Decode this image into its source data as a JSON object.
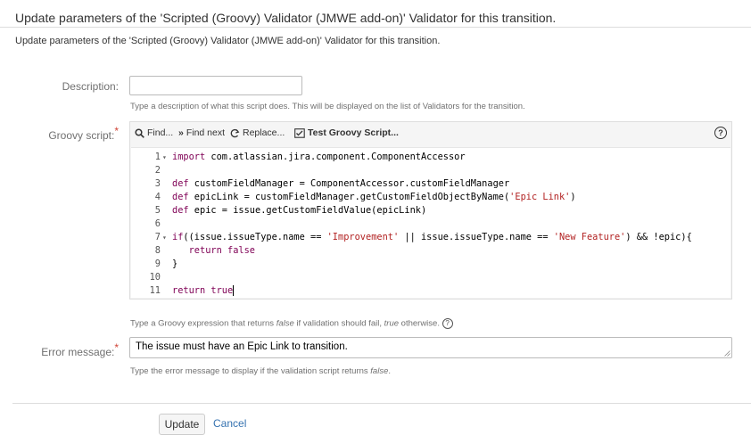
{
  "page": {
    "title": "Update parameters of the 'Scripted (Groovy) Validator (JMWE add-on)' Validator for this transition.",
    "intro": "Update parameters of the 'Scripted (Groovy) Validator (JMWE add-on)' Validator for this transition."
  },
  "description": {
    "label": "Description:",
    "value": "",
    "help": "Type a description of what this script does. This will be displayed on the list of Validators for the transition."
  },
  "groovy": {
    "label": "Groovy script:",
    "required_mark": "*",
    "toolbar": {
      "find": "Find...",
      "find_next": "Find next",
      "replace": "Replace...",
      "test": "Test Groovy Script..."
    },
    "help_before": "Type a Groovy expression that returns ",
    "help_em1": "false",
    "help_mid": " if validation should fail, ",
    "help_em2": "true",
    "help_after": " otherwise.",
    "lines": [
      {
        "n": "1",
        "fold": "▾",
        "parts": [
          {
            "t": "import",
            "c": "kw"
          },
          {
            "t": " com.atlassian.jira.component.ComponentAccessor",
            "c": ""
          }
        ]
      },
      {
        "n": "2",
        "fold": "",
        "parts": []
      },
      {
        "n": "3",
        "fold": "",
        "parts": [
          {
            "t": "def",
            "c": "kw"
          },
          {
            "t": " customFieldManager = ComponentAccessor.customFieldManager",
            "c": ""
          }
        ]
      },
      {
        "n": "4",
        "fold": "",
        "parts": [
          {
            "t": "def",
            "c": "kw"
          },
          {
            "t": " epicLink = customFieldManager.getCustomFieldObjectByName(",
            "c": ""
          },
          {
            "t": "'Epic Link'",
            "c": "str"
          },
          {
            "t": ")",
            "c": ""
          }
        ]
      },
      {
        "n": "5",
        "fold": "",
        "parts": [
          {
            "t": "def",
            "c": "kw"
          },
          {
            "t": " epic = issue.getCustomFieldValue(epicLink)",
            "c": ""
          }
        ]
      },
      {
        "n": "6",
        "fold": "",
        "parts": []
      },
      {
        "n": "7",
        "fold": "▾",
        "parts": [
          {
            "t": "if",
            "c": "kw"
          },
          {
            "t": "((issue.issueType.name == ",
            "c": ""
          },
          {
            "t": "'Improvement'",
            "c": "str"
          },
          {
            "t": " || issue.issueType.name == ",
            "c": ""
          },
          {
            "t": "'New Feature'",
            "c": "str"
          },
          {
            "t": ") && !epic){",
            "c": ""
          }
        ]
      },
      {
        "n": "8",
        "fold": "",
        "parts": [
          {
            "t": "   return",
            "c": "kw"
          },
          {
            "t": " false",
            "c": "kw"
          }
        ]
      },
      {
        "n": "9",
        "fold": "",
        "parts": [
          {
            "t": "}",
            "c": ""
          }
        ]
      },
      {
        "n": "10",
        "fold": "",
        "parts": []
      },
      {
        "n": "11",
        "fold": "",
        "parts": [
          {
            "t": "return",
            "c": "kw"
          },
          {
            "t": " true",
            "c": "kw"
          }
        ]
      }
    ]
  },
  "error_message": {
    "label": "Error message:",
    "required_mark": "*",
    "value": "The issue must have an Epic Link to transition.",
    "help_before": "Type the error message to display if the validation script returns ",
    "help_em": "false",
    "help_after": "."
  },
  "actions": {
    "update": "Update",
    "cancel": "Cancel"
  },
  "colors": {
    "link": "#3572b0",
    "required": "#d04437",
    "keyword": "#7f0055",
    "string": "#b22222"
  }
}
